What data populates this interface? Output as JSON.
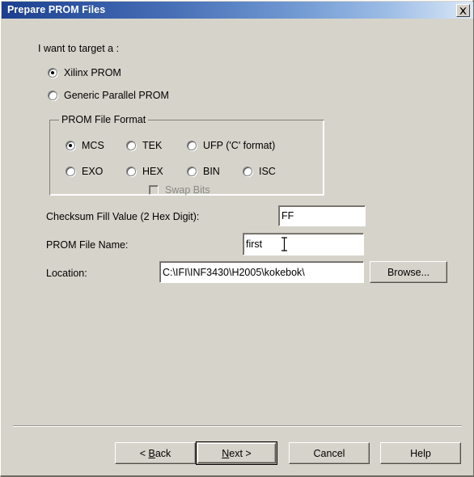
{
  "window": {
    "title": "Prepare PROM Files",
    "close_label": "×",
    "close_icon": "close-icon"
  },
  "form": {
    "target_prompt": "I want to target a :",
    "target_options": [
      {
        "label": "Xilinx PROM",
        "selected": true
      },
      {
        "label": "Generic Parallel PROM",
        "selected": false
      }
    ],
    "format_group": {
      "title": "PROM File Format",
      "options": [
        {
          "label": "MCS",
          "selected": true
        },
        {
          "label": "TEK",
          "selected": false
        },
        {
          "label": "UFP ('C' format)",
          "selected": false
        },
        {
          "label": "EXO",
          "selected": false
        },
        {
          "label": "HEX",
          "selected": false
        },
        {
          "label": "BIN",
          "selected": false
        },
        {
          "label": "ISC",
          "selected": false
        }
      ],
      "swap_bits": {
        "label": "Swap Bits",
        "checked": false,
        "disabled": true
      }
    },
    "fields": [
      {
        "label": "Checksum Fill Value (2 Hex Digit):",
        "value": "FF",
        "placeholder": ""
      },
      {
        "label": "PROM File Name:",
        "value": "first",
        "placeholder": ""
      },
      {
        "label": "Location:",
        "value": "C:\\IFI\\INF3430\\H2005\\kokebok\\",
        "placeholder": ""
      }
    ],
    "browse_label": "Browse..."
  },
  "buttons": {
    "back": {
      "pre": "< ",
      "acc": "B",
      "post": "ack"
    },
    "next": {
      "pre": "",
      "acc": "N",
      "post": "ext >"
    },
    "cancel": "Cancel",
    "help": "Help"
  },
  "colors": {
    "dialog_face": "#d6d3ca",
    "title_start": "#1b3f8f",
    "title_end": "#dce9f7",
    "title_text": "#ffffff",
    "field_bg": "#ffffff",
    "disabled_text": "#8a8a86"
  }
}
